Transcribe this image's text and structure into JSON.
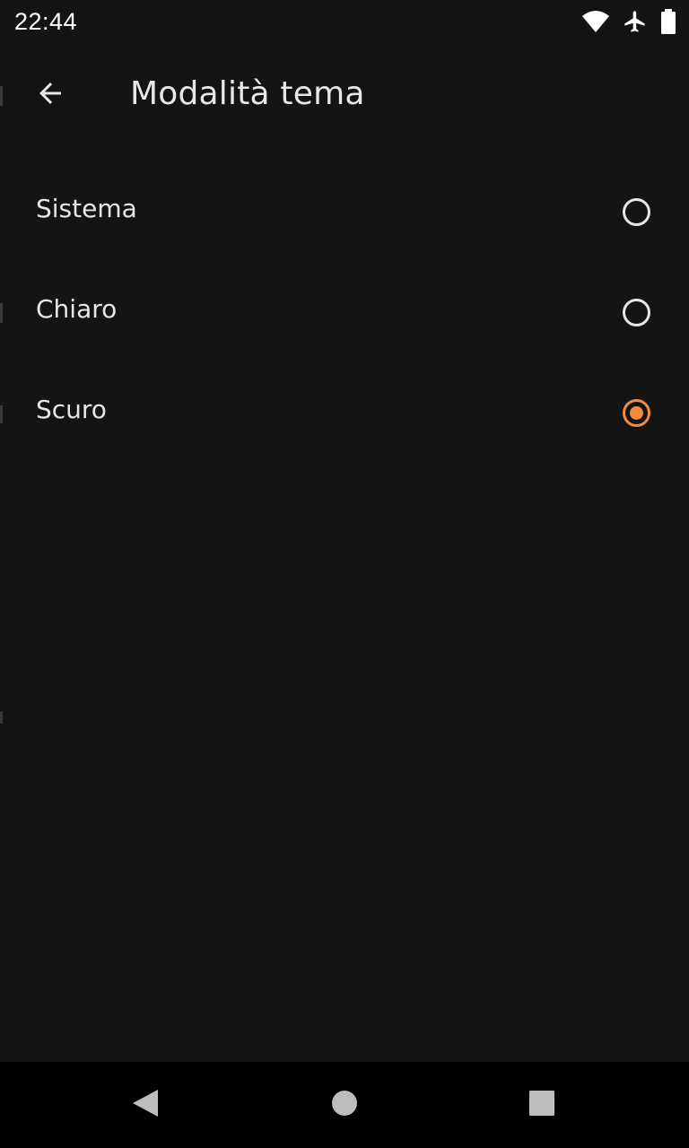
{
  "status_bar": {
    "time": "22:44",
    "icons": [
      "wifi-icon",
      "airplane-mode-icon",
      "battery-icon"
    ]
  },
  "app_bar": {
    "back_icon": "back-arrow-icon",
    "title": "Modalità tema"
  },
  "theme_options": [
    {
      "label": "Sistema",
      "selected": false
    },
    {
      "label": "Chiaro",
      "selected": false
    },
    {
      "label": "Scuro",
      "selected": true
    }
  ],
  "nav_bar": {
    "buttons": [
      "nav-back-icon",
      "nav-home-icon",
      "nav-recents-icon"
    ]
  },
  "colors": {
    "background": "#141414",
    "accent": "#f28b3c",
    "text": "#e6e6e6",
    "nav_background": "#000000"
  }
}
